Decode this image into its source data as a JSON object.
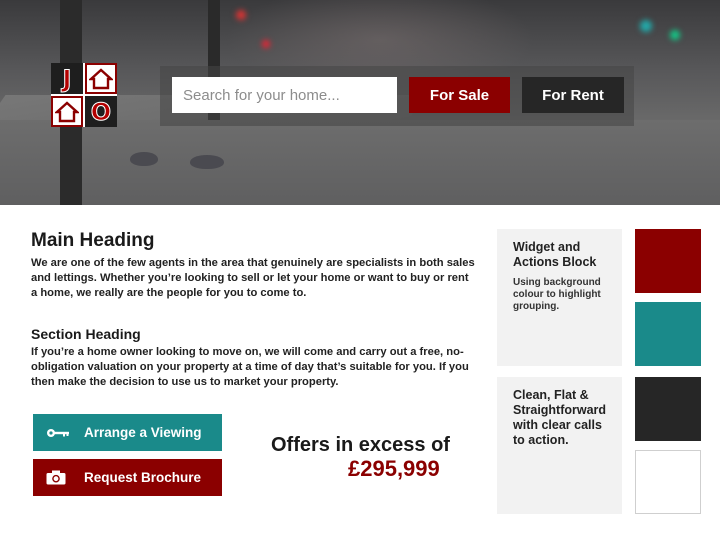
{
  "logo": {
    "letters": [
      "J",
      "O"
    ]
  },
  "search": {
    "placeholder": "Search for your home..."
  },
  "buttons": {
    "for_sale": "For Sale",
    "for_rent": "For Rent"
  },
  "main": {
    "heading": "Main Heading",
    "intro": "We are one of the few agents in the area that genuinely are specialists in both sales and lettings. Whether you’re looking to sell or let your home or want to buy or rent a home, we really are the people for you to come to.",
    "section_heading": "Section Heading",
    "section_text": "If you’re a home owner looking to move on, we will come and carry out a free, no-obligation valuation on your property at a time of day that’s suitable for you. If you then make the decision to use us to market your property."
  },
  "cta": {
    "viewing": {
      "label": "Arrange a Viewing",
      "icon": "key-icon"
    },
    "brochure": {
      "label": "Request Brochure",
      "icon": "camera-icon"
    }
  },
  "offers": {
    "label": "Offers in excess of",
    "price": "£295,999"
  },
  "widgets": [
    {
      "title": "Widget and Actions Block",
      "text": "Using background colour to highlight grouping."
    },
    {
      "title": "Clean, Flat & Straightforward with clear calls to action.",
      "text": ""
    }
  ],
  "colors": {
    "brand_red": "#8b0000",
    "teal": "#1a8a8a",
    "dark": "#262626",
    "white": "#ffffff",
    "widget_bg": "#f2f2f2"
  },
  "swatches": [
    "#8b0000",
    "#1a8a8a",
    "#262626",
    "#ffffff"
  ]
}
